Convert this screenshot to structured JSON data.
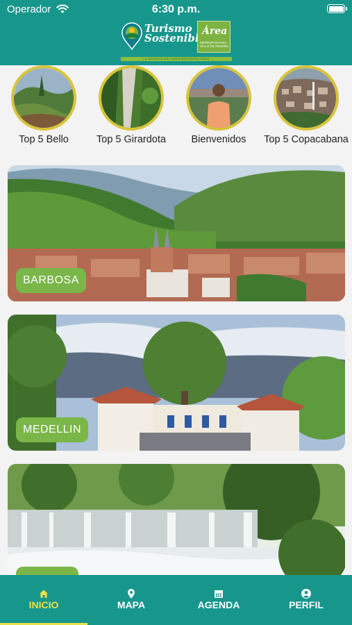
{
  "status_bar": {
    "carrier": "Operador",
    "time": "6:30 p.m."
  },
  "header": {
    "logo_title_line1": "Turismo",
    "logo_title_line2": "Sostenible",
    "logo_area_word": "Área",
    "logo_area_small": "METROPOLITANA VALLE DE ABURRÁ",
    "logo_strip_text": "LA APUESTA DEL ÁREA METROPOLITANA"
  },
  "stories": [
    {
      "label": "Top 5 Bello"
    },
    {
      "label": "Top 5 Girardota"
    },
    {
      "label": "Bienvenidos"
    },
    {
      "label": "Top 5 Copacabana"
    }
  ],
  "cards": [
    {
      "label": "BARBOSA"
    },
    {
      "label": "MEDELLIN"
    },
    {
      "label": ""
    }
  ],
  "bottom_nav": {
    "items": [
      {
        "label": "INICIO",
        "icon": "home-icon",
        "active": true
      },
      {
        "label": "MAPA",
        "icon": "map-pin-icon",
        "active": false
      },
      {
        "label": "AGENDA",
        "icon": "calendar-icon",
        "active": false
      },
      {
        "label": "PERFIL",
        "icon": "user-icon",
        "active": false
      }
    ]
  },
  "colors": {
    "primary": "#17968c",
    "accent": "#e8e24a",
    "badge": "#7ab648",
    "circle_border": "#d8c43a"
  }
}
